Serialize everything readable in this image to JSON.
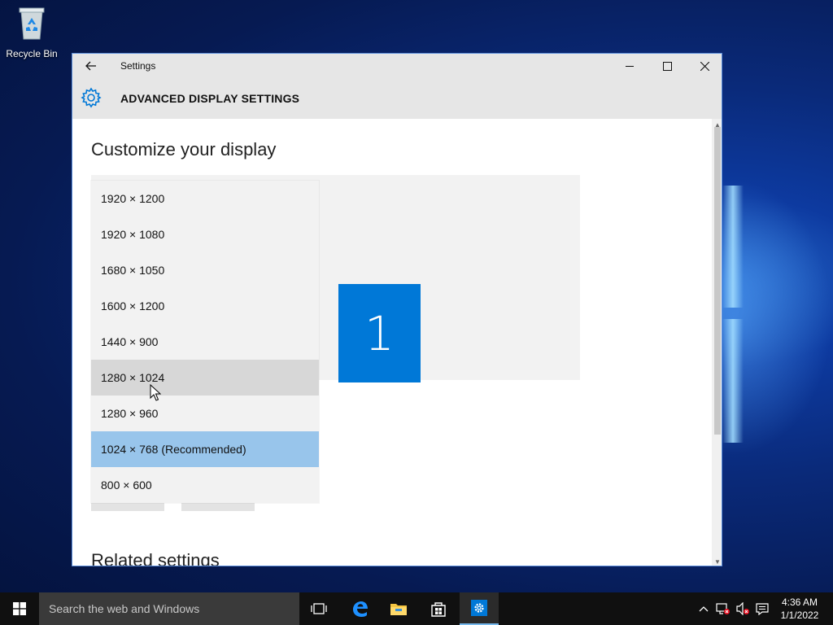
{
  "desktop": {
    "recycle_bin_label": "Recycle Bin"
  },
  "window": {
    "title": "Settings",
    "section_title": "ADVANCED DISPLAY SETTINGS",
    "heading": "Customize your display",
    "monitor_number": "1",
    "related_heading": "Related settings"
  },
  "resolution_options": [
    {
      "label": "1920 × 1200"
    },
    {
      "label": "1920 × 1080"
    },
    {
      "label": "1680 × 1050"
    },
    {
      "label": "1600 × 1200"
    },
    {
      "label": "1440 × 900"
    },
    {
      "label": "1280 × 1024",
      "state": "hover"
    },
    {
      "label": "1280 × 960"
    },
    {
      "label": "1024 × 768 (Recommended)",
      "state": "selected"
    },
    {
      "label": "800 × 600"
    }
  ],
  "taskbar": {
    "search_placeholder": "Search the web and Windows",
    "time": "4:36 AM",
    "date": "1/1/2022"
  },
  "colors": {
    "accent": "#0078d7",
    "selected_item": "#98c5eb",
    "hover_item": "#d7d7d7"
  }
}
